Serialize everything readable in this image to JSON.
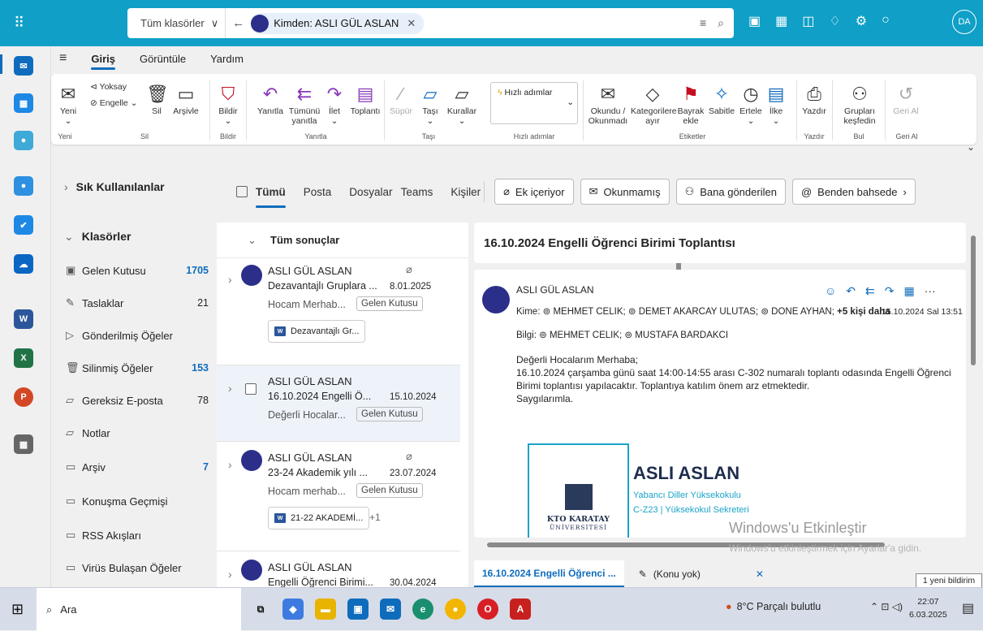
{
  "search": {
    "scope": "Tüm klasörler",
    "chip": "Kimden: ASLI GÜL ASLAN",
    "user_initials": "DA"
  },
  "nav_tabs": [
    "Giriş",
    "Görüntüle",
    "Yardım"
  ],
  "ribbon": {
    "yeni": "Yeni",
    "yoksay": "Yoksay",
    "engelle": "Engelle",
    "sil": "Sil",
    "arsivle": "Arşivle",
    "bildir": "Bildir",
    "yanitla": "Yanıtla",
    "tumunu_yanitla": "Tümünü yanıtla",
    "ilet": "İlet",
    "toplanti": "Toplantı",
    "supur": "Süpür",
    "tasi": "Taşı",
    "kurallar": "Kurallar",
    "hizli_adimlar": "Hızlı adımlar",
    "okundu": "Okundu / Okunmadı",
    "kategoriler": "Kategorilere ayır",
    "bayrak": "Bayrak ekle",
    "sabitle": "Sabitle",
    "ertele": "Ertele",
    "ilke": "İlke",
    "yazdir": "Yazdır",
    "gruplari": "Grupları keşfedin",
    "geri_al": "Geri Al",
    "groups": {
      "yeni": "Yeni",
      "sil": "Sil",
      "bildir": "Bildir",
      "yanitla": "Yanıtla",
      "tasi": "Taşı",
      "hizli": "Hızlı adımlar",
      "etiketler": "Etiketler",
      "yazdir": "Yazdır",
      "bul": "Bul",
      "geri": "Geri Al"
    }
  },
  "folders": {
    "favorites": "Sık Kullanılanlar",
    "header": "Klasörler",
    "items": [
      {
        "label": "Gelen Kutusu",
        "count": "1705"
      },
      {
        "label": "Taslaklar",
        "count": "21"
      },
      {
        "label": "Gönderilmiş Öğeler",
        "count": ""
      },
      {
        "label": "Silinmiş Öğeler",
        "count": "153"
      },
      {
        "label": "Gereksiz E-posta",
        "count": "78"
      },
      {
        "label": "Notlar",
        "count": ""
      },
      {
        "label": "Arşiv",
        "count": "7"
      },
      {
        "label": "Konuşma Geçmişi",
        "count": ""
      },
      {
        "label": "RSS Akışları",
        "count": ""
      },
      {
        "label": "Virüs Bulaşan Öğeler",
        "count": ""
      }
    ]
  },
  "filters": {
    "tabs": [
      "Tümü",
      "Posta",
      "Dosyalar",
      "Teams",
      "Kişiler"
    ],
    "buttons": [
      "Ek içeriyor",
      "Okunmamış",
      "Bana gönderilen",
      "Benden bahsede"
    ]
  },
  "list": {
    "header": "Tüm sonuçlar",
    "items": [
      {
        "name": "ASLI GÜL ASLAN",
        "subject": "Dezavantajlı Gruplara ...",
        "date": "8.01.2025",
        "preview": "Hocam Merhab...",
        "folder": "Gelen Kutusu",
        "attachment": "Dezavantajlı Gr..."
      },
      {
        "name": "ASLI GÜL ASLAN",
        "subject": "16.10.2024 Engelli Ö...",
        "date": "15.10.2024",
        "preview": "Değerli Hocalar...",
        "folder": "Gelen Kutusu"
      },
      {
        "name": "ASLI GÜL ASLAN",
        "subject": "23-24 Akademik yılı ...",
        "date": "23.07.2024",
        "preview": "Hocam merhab...",
        "folder": "Gelen Kutusu",
        "attachment": "21-22 AKADEMİ...",
        "more": "+1"
      },
      {
        "name": "ASLI GÜL ASLAN",
        "subject": "Engelli Öğrenci Birimi...",
        "date": "30.04.2024"
      }
    ]
  },
  "reading": {
    "subject": "16.10.2024 Engelli Öğrenci Birimi Toplantısı",
    "from": "ASLI GÜL ASLAN",
    "to_label": "Kime:",
    "to": "MEHMET CELIK;",
    "to2": "DEMET AKARCAY ULUTAS;",
    "to3": "DONE AYHAN;",
    "to_more": "+5 kişi daha",
    "date": "15.10.2024 Sal 13:51",
    "cc_label": "Bilgi:",
    "cc1": "MEHMET CELIK;",
    "cc2": "MUSTAFA BARDAKCI",
    "body": [
      "Değerli Hocalarım Merhaba;",
      "16.10.2024 çarşamba günü saat 14:00-14:55 arası C-302 numaralı toplantı odasında Engelli Öğrenci Birimi toplantısı yapılacaktır. Toplantıya katılım önem arz etmektedir.",
      "Saygılarımla."
    ],
    "sig_name": "ASLI ASLAN",
    "sig_line1": "Yabancı Diller Yüksekokulu",
    "sig_line2": "C-Z23 | Yüksekokul Sekreteri",
    "logo_t1": "KTO KARATAY",
    "logo_t2": "ÜNİVERSİTESİ"
  },
  "watermark": {
    "title": "Windows'u Etkinleştir",
    "sub": "Windows'u etkinleştirmek için Ayarlar'a gidin."
  },
  "bottom_tabs": [
    "16.10.2024 Engelli Öğrenci ...",
    "(Konu yok)"
  ],
  "notification": "1 yeni bildirim",
  "taskbar": {
    "search": "Ara",
    "weather": "8°C Parçalı bulutlu",
    "time": "22:07",
    "date": "6.03.2025"
  }
}
